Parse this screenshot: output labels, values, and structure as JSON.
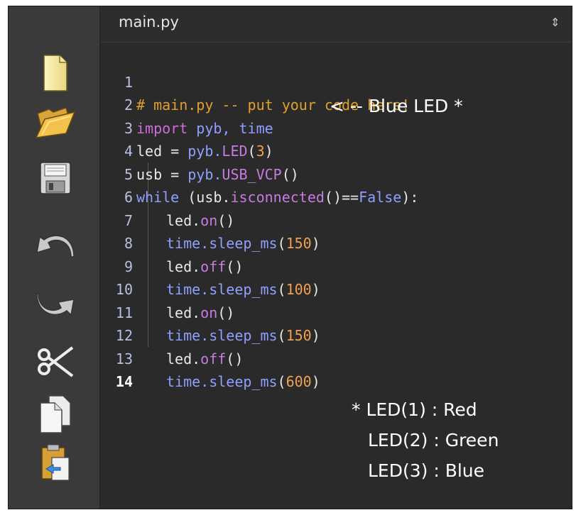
{
  "editor": {
    "tab_title": "main.py",
    "tab_sort_symbol": "⇕",
    "tab_close_symbol": "✕"
  },
  "toolbar": {
    "items": [
      {
        "icon": "new-file-icon"
      },
      {
        "icon": "open-folder-icon"
      },
      {
        "icon": "save-floppy-icon"
      },
      {
        "icon": "undo-icon"
      },
      {
        "icon": "redo-icon"
      },
      {
        "icon": "cut-scissors-icon"
      },
      {
        "icon": "copy-icon"
      },
      {
        "icon": "paste-icon"
      }
    ]
  },
  "code": {
    "lines": [
      {
        "n": "1"
      },
      {
        "n": "2"
      },
      {
        "n": "3"
      },
      {
        "n": "4"
      },
      {
        "n": "5"
      },
      {
        "n": "6"
      },
      {
        "n": "7"
      },
      {
        "n": "8"
      },
      {
        "n": "9"
      },
      {
        "n": "10"
      },
      {
        "n": "11"
      },
      {
        "n": "12"
      },
      {
        "n": "13"
      },
      {
        "n": "14"
      }
    ],
    "tokens": {
      "l1": "# main.py -- put your code here!",
      "l2_kw": "import",
      "l2_rest": " pyb, time",
      "l3_a": "led = ",
      "l3_b": "pyb.",
      "l3_c": "LED",
      "l3_d": "(",
      "l3_e": "3",
      "l3_f": ")",
      "l4_a": "usb = ",
      "l4_b": "pyb.",
      "l4_c": "USB_VCP",
      "l4_d": "()",
      "l5_kw": "while",
      "l5_a": " (usb.",
      "l5_b": "isconnected",
      "l5_c": "()==",
      "l5_d": "False",
      "l5_e": "):",
      "l6_a": "led.",
      "l6_b": "on",
      "l6_c": "()",
      "l7_a": "time.",
      "l7_b": "sleep_ms",
      "l7_c": "(",
      "l7_d": "150",
      "l7_e": ")",
      "l8_a": "led.",
      "l8_b": "off",
      "l8_c": "()",
      "l9_a": "time.",
      "l9_b": "sleep_ms",
      "l9_c": "(",
      "l9_d": "100",
      "l9_e": ")",
      "l10_a": "led.",
      "l10_b": "on",
      "l10_c": "()",
      "l11_a": "time.",
      "l11_b": "sleep_ms",
      "l11_c": "(",
      "l11_d": "150",
      "l11_e": ")",
      "l12_a": "led.",
      "l12_b": "off",
      "l12_c": "()",
      "l13_a": "time.",
      "l13_b": "sleep_ms",
      "l13_c": "(",
      "l13_d": "600",
      "l13_e": ")"
    }
  },
  "annotations": {
    "arrow_note": "< -- Blue LED *",
    "legend_1": "* LED(1) : Red",
    "legend_2": "LED(2) : Green",
    "legend_3": "LED(3) : Blue"
  }
}
